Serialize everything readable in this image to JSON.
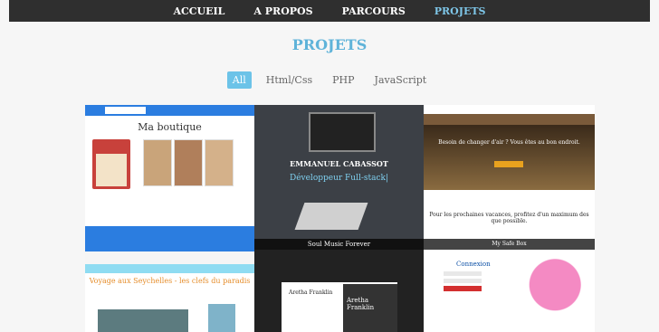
{
  "nav": {
    "items": [
      {
        "label": "ACCUEIL",
        "active": false
      },
      {
        "label": "A PROPOS",
        "active": false
      },
      {
        "label": "PARCOURS",
        "active": false
      },
      {
        "label": "PROJETS",
        "active": true
      }
    ]
  },
  "section": {
    "title": "PROJETS"
  },
  "filters": {
    "items": [
      "All",
      "Html/Css",
      "PHP",
      "JavaScript"
    ],
    "active": "All"
  },
  "projects": {
    "p1": {
      "title": "Ma boutique"
    },
    "p2": {
      "name": "EMMANUEL CABASSOT",
      "subtitle": "Développeur Full-stack|"
    },
    "p3": {
      "hero": "Besoin de changer d'air ? Vous êtes au bon endroit.",
      "text": "Pour les prochaines vacances, profitez d'un maximum des que possible."
    },
    "p4": {
      "title": "Voyage aux Seychelles - les clefs du paradis"
    },
    "p5": {
      "header": "Soul Music Forever",
      "card": "Aretha Franklin",
      "photo": "Aretha Franklin"
    },
    "p6": {
      "header": "My Safe Box",
      "title": "Connexion"
    }
  },
  "colors": {
    "accent": "#5fb3d9",
    "navbar": "#2f2f2f",
    "filter_active": "#6cc3e8"
  }
}
